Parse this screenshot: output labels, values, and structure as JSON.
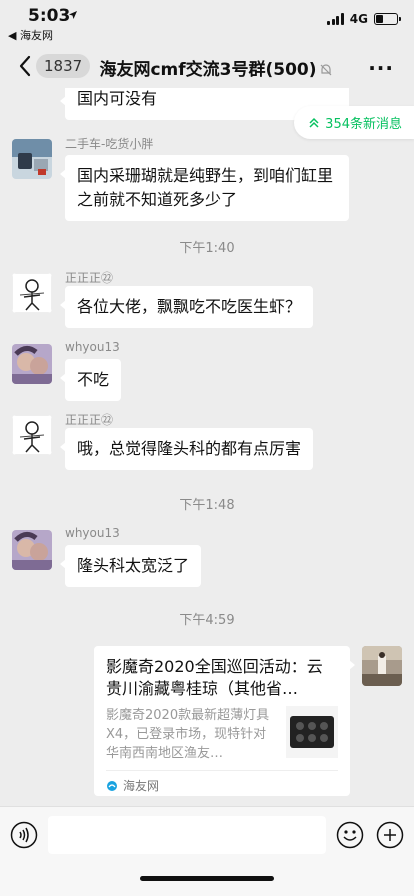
{
  "status_bar": {
    "time": "5:03",
    "back_app": "◀ 海友网",
    "network": "4G"
  },
  "nav": {
    "unread_count": "1837",
    "title": "海友网cmf交流3号群(500)"
  },
  "new_messages_label": "354条新消息",
  "messages": [
    {
      "sender": "",
      "text": "国内可没有"
    },
    {
      "sender": "二手车-吃货小胖",
      "text": "国内采珊瑚就是纯野生，到咱们缸里之前就不知道死多少了"
    },
    {
      "sender": "正正正㉒",
      "text": "各位大佬，飘飘吃不吃医生虾？"
    },
    {
      "sender": "whyou13",
      "text": "不吃"
    },
    {
      "sender": "正正正㉒",
      "text": "哦，总觉得隆头科的都有点厉害"
    },
    {
      "sender": "whyou13",
      "text": "隆头科太宽泛了"
    }
  ],
  "time_separators": [
    "下午1:40",
    "下午1:48",
    "下午4:59"
  ],
  "link_card": {
    "title": "影魔奇2020全国巡回活动：云贵川渝藏粤桂琼（其他省…",
    "description": "影魔奇2020款最新超薄灯具X4，已登录市场，现特针对华南西南地区渔友…",
    "source": "海友网"
  },
  "input": {
    "value": ""
  },
  "colors": {
    "accent": "#07c160",
    "background": "#ededed"
  }
}
